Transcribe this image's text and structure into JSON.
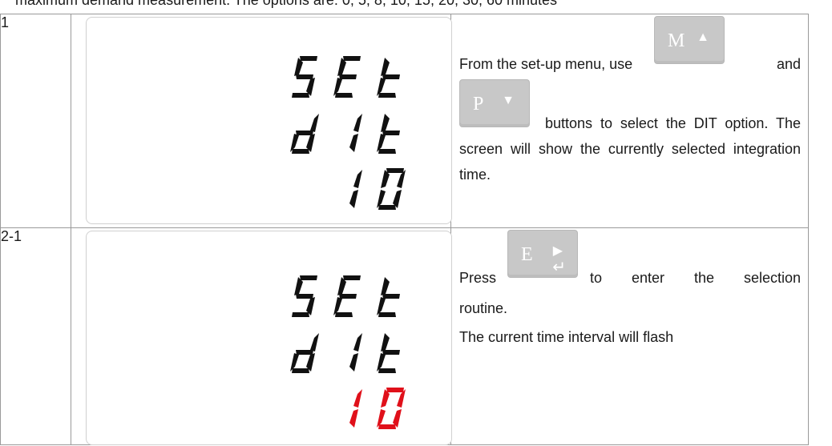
{
  "intro_text": "maximum demand measurement. The options are: 0, 5, 8, 10, 15, 20, 30, 60 minutes",
  "steps": [
    {
      "number": "1",
      "display": [
        "SEt",
        "dIt",
        "10"
      ],
      "text": {
        "a": "From the set-up menu, use",
        "b": "and",
        "c": "buttons to select the DIT option. The screen will show the currently selected integration time."
      },
      "buttons": [
        {
          "letter": "M",
          "arrow": "▲"
        },
        {
          "letter": "P",
          "arrow": "▼"
        }
      ]
    },
    {
      "number": "2-1",
      "display": [
        "SEt",
        "dIt",
        "10"
      ],
      "text": {
        "a": "Press",
        "b": "to enter the selection routine.",
        "c": "The current time interval will flash"
      },
      "buttons": [
        {
          "letter": "E",
          "arrow": "▶",
          "enter": "↵"
        }
      ]
    }
  ],
  "colors": {
    "lcd_segment": "#111111",
    "flash_segment": "#e0101a",
    "button_face": "#c8c8c8"
  }
}
